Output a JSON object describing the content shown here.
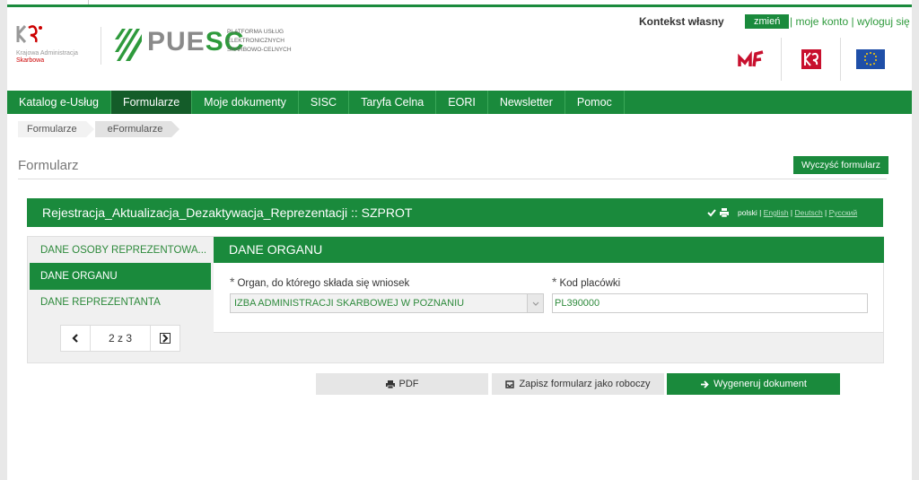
{
  "header": {
    "kas": {
      "line1": "Krajowa Administracja",
      "line2": "Skarbowa"
    },
    "puesc": {
      "word_grey": "PUE",
      "word_green": "SC",
      "subtitle": [
        "PLATFORMA USŁUG",
        "ELEKTRONICZNYCH",
        "SKARBOWO-CELNYCH"
      ]
    },
    "context_label": "Kontekst własny",
    "change_label": "zmień",
    "my_account_label": "moje konto",
    "logout_label": "wyloguj się",
    "emblems": [
      "mf-logo-icon",
      "kas-logo-icon",
      "eu-flag-icon"
    ]
  },
  "nav": {
    "items": [
      {
        "label": "Katalog e-Usług"
      },
      {
        "label": "Formularze",
        "active": true
      },
      {
        "label": "Moje dokumenty"
      },
      {
        "label": "SISC"
      },
      {
        "label": "Taryfa Celna"
      },
      {
        "label": "EORI"
      },
      {
        "label": "Newsletter"
      },
      {
        "label": "Pomoc"
      }
    ]
  },
  "breadcrumb": [
    "Formularze",
    "eFormularze"
  ],
  "page": {
    "heading": "Formularz",
    "clear_button": "Wyczyść formularz"
  },
  "form": {
    "title": "Rejestracja_Aktualizacja_Dezaktywacja_Reprezentacji :: SZPROT",
    "languages": {
      "current": "polski",
      "links": [
        "English",
        "Deutsch",
        "Русский"
      ]
    },
    "sidebar": [
      {
        "label": "DANE OSOBY REPREZENTOWA..."
      },
      {
        "label": "DANE ORGANU",
        "active": true
      },
      {
        "label": "DANE REPREZENTANTA"
      }
    ],
    "pager": {
      "text": "2 z 3"
    },
    "section": {
      "title": "DANE ORGANU",
      "organ_label": "Organ, do którego składa się wniosek",
      "organ_value": "IZBA ADMINISTRACJI SKARBOWEJ W POZNANIU",
      "office_label": "Kod placówki",
      "office_value": "PL390000"
    }
  },
  "actions": {
    "pdf": "PDF",
    "save_draft": "Zapisz formularz jako roboczy",
    "generate": "Wygeneruj dokument"
  },
  "colors": {
    "brand_green": "#1a8a3c",
    "active_nav": "#145c29"
  }
}
